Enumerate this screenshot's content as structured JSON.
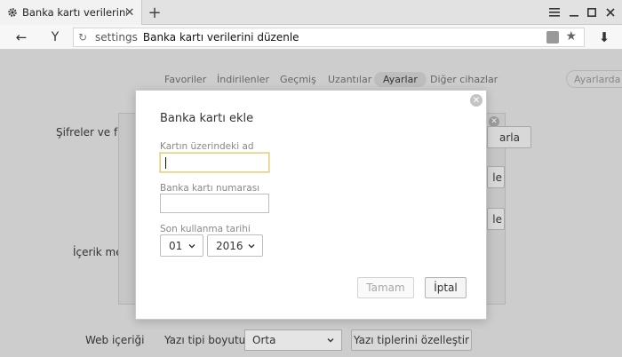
{
  "tab": {
    "title": "Banka kartı verilerini düzenle",
    "close": "✕",
    "new_tab": "+"
  },
  "window_controls": {
    "menu": "≡",
    "minimize": "—",
    "maximize": "☐",
    "close": "✕"
  },
  "toolbar": {
    "back": "←",
    "brand": "Y",
    "url_host": "settings",
    "url_path": "Banka kartı verilerini düzenle",
    "download": "⬇"
  },
  "nav": {
    "items": [
      "Favoriler",
      "İndirilenler",
      "Geçmiş",
      "Uzantılar",
      "Ayarlar",
      "Diğer cihazlar"
    ],
    "active": "Ayarlar",
    "search_placeholder": "Ayarlarda ara"
  },
  "background": {
    "section_passwords": "Şifreler ve for",
    "section_content": "İçerik me",
    "section_web": "Web içeriği",
    "btn_arla": "arla",
    "btn_le_1": "le",
    "btn_le_2": "le",
    "font_size_label": "Yazı tipi boyutu:",
    "font_size_value": "Orta",
    "customize_fonts": "Yazı tiplerini özelleştir"
  },
  "modal": {
    "title": "Banka kartı ekle",
    "name_label": "Kartın üzerindeki ad",
    "name_value": "",
    "number_label": "Banka kartı numarası",
    "number_value": "",
    "expiry_label": "Son kullanma tarihi",
    "month": "01",
    "year": "2016",
    "save": "Tamam",
    "cancel": "İptal"
  },
  "colors": {
    "focus_border": "#e6cf86",
    "page_bg": "#cdcdcd",
    "modal_bg": "#ffffff"
  }
}
